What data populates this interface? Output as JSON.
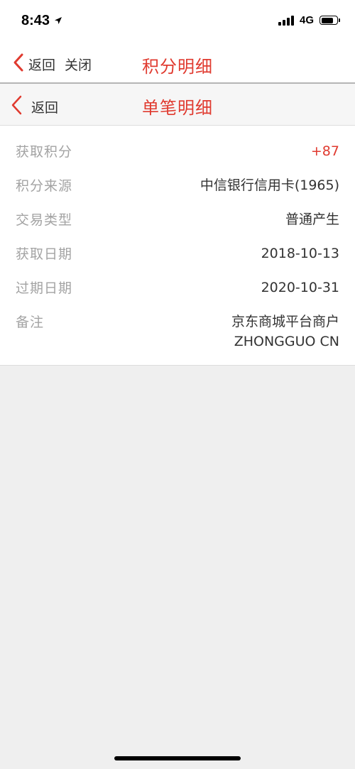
{
  "status": {
    "time": "8:43",
    "network": "4G"
  },
  "nav_top": {
    "back_label": "返回",
    "close_label": "关闭",
    "title": "积分明细"
  },
  "nav_sub": {
    "back_label": "返回",
    "title": "单笔明细"
  },
  "details": [
    {
      "label": "获取积分",
      "value": "+87"
    },
    {
      "label": "积分来源",
      "value": "中信银行信用卡(1965)"
    },
    {
      "label": "交易类型",
      "value": "普通产生"
    },
    {
      "label": "获取日期",
      "value": "2018-10-13"
    },
    {
      "label": "过期日期",
      "value": "2020-10-31"
    },
    {
      "label": "备注",
      "value": "京东商城平台商户",
      "value_line2": "ZHONGGUO CN"
    }
  ],
  "colors": {
    "accent": "#e03a2f",
    "label_gray": "#a3a3a3",
    "background": "#efefef"
  },
  "icons": {
    "back": "chevron-left-icon",
    "location": "location-arrow-icon",
    "signal": "cellular-signal-icon",
    "battery": "battery-icon"
  }
}
